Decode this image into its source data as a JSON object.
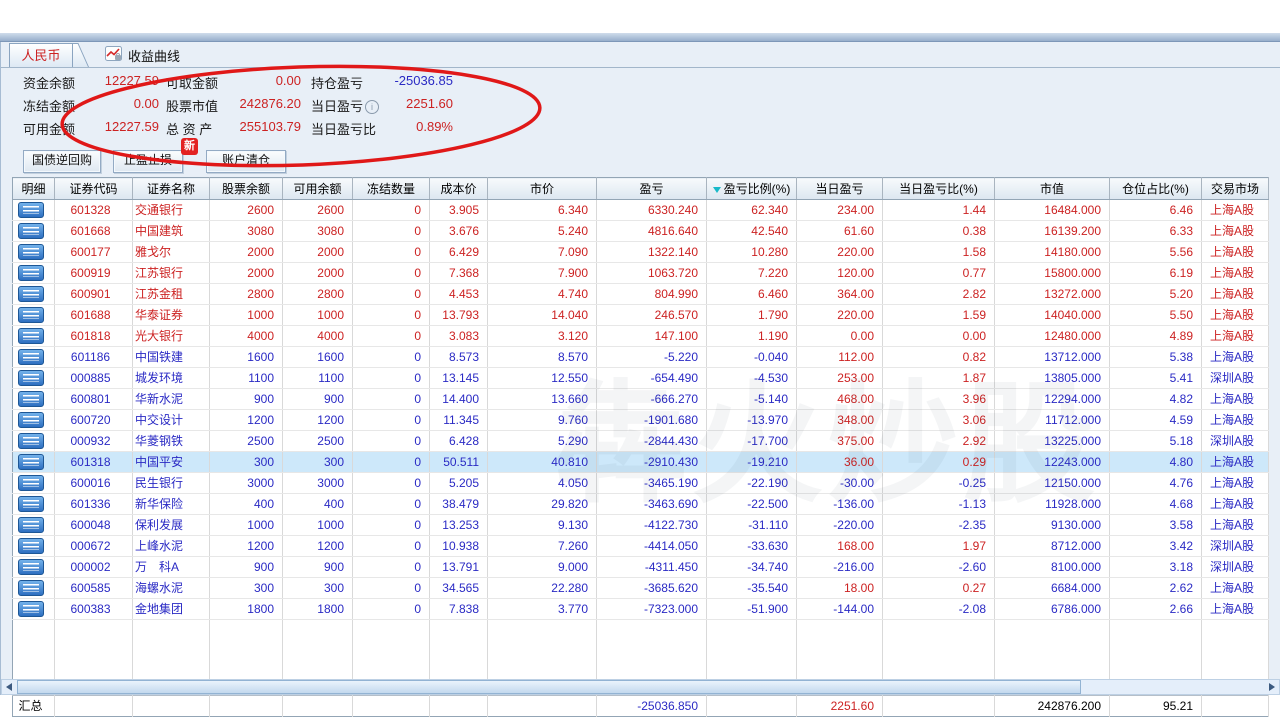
{
  "tabs": {
    "currency": "人民币",
    "curve": "收益曲线"
  },
  "account": {
    "rows": [
      [
        {
          "label": "资金余额",
          "value": "12227.59",
          "color": "red"
        },
        {
          "label": "可取金额",
          "value": "0.00",
          "color": "red"
        },
        {
          "label": "持仓盈亏",
          "value": "-25036.85",
          "color": "blue"
        }
      ],
      [
        {
          "label": "冻结金额",
          "value": "0.00",
          "color": "red"
        },
        {
          "label": "股票市值",
          "value": "242876.20",
          "color": "red"
        },
        {
          "label": "当日盈亏",
          "value": "2251.60",
          "color": "red",
          "info": true
        }
      ],
      [
        {
          "label": "可用金额",
          "value": "12227.59",
          "color": "red"
        },
        {
          "label": "总 资 产",
          "value": "255103.79",
          "color": "red"
        },
        {
          "label": "当日盈亏比",
          "value": "0.89%",
          "color": "red"
        }
      ]
    ]
  },
  "buttons": {
    "reverse_repo": "国债逆回购",
    "stop_profit_loss": "止盈止损",
    "clear_account": "账户清仓"
  },
  "badge_new": "新",
  "watermark": "犇火炒股",
  "colors": {
    "up": "#cc2222",
    "down": "#2a2ac4",
    "annotation": "#e01818",
    "sort_indicator": "#17b9c9",
    "highlight_row": "#cde8fa"
  },
  "table": {
    "columns": [
      {
        "key": "detail",
        "label": "明细",
        "width": 42,
        "align": "c"
      },
      {
        "key": "code",
        "label": "证券代码",
        "width": 78,
        "align": "c"
      },
      {
        "key": "name",
        "label": "证券名称",
        "width": 77,
        "align": "l"
      },
      {
        "key": "balance",
        "label": "股票余额",
        "width": 73,
        "align": "r"
      },
      {
        "key": "available",
        "label": "可用余额",
        "width": 70,
        "align": "r"
      },
      {
        "key": "frozen",
        "label": "冻结数量",
        "width": 77,
        "align": "r"
      },
      {
        "key": "cost",
        "label": "成本价",
        "width": 58,
        "align": "r"
      },
      {
        "key": "price",
        "label": "市价",
        "width": 109,
        "align": "r"
      },
      {
        "key": "pl",
        "label": "盈亏",
        "width": 110,
        "align": "r"
      },
      {
        "key": "pl_pct",
        "label": "盈亏比例(%)",
        "width": 90,
        "align": "r",
        "sorted": true
      },
      {
        "key": "day_pl",
        "label": "当日盈亏",
        "width": 86,
        "align": "r"
      },
      {
        "key": "day_pl_pct",
        "label": "当日盈亏比(%)",
        "width": 112,
        "align": "r"
      },
      {
        "key": "mkt_val",
        "label": "市值",
        "width": 115,
        "align": "r"
      },
      {
        "key": "pos_pct",
        "label": "仓位占比(%)",
        "width": 92,
        "align": "r"
      },
      {
        "key": "market",
        "label": "交易市场",
        "width": 67,
        "align": "c"
      }
    ],
    "rows": [
      {
        "code": "601328",
        "name": "交通银行",
        "balance": "2600",
        "available": "2600",
        "frozen": "0",
        "cost": "3.905",
        "price": "6.340",
        "pl": "6330.240",
        "pl_pct": "62.340",
        "day_pl": "234.00",
        "day_pl_pct": "1.44",
        "mkt_val": "16484.000",
        "pos_pct": "6.46",
        "market": "上海A股",
        "trend": "up"
      },
      {
        "code": "601668",
        "name": "中国建筑",
        "balance": "3080",
        "available": "3080",
        "frozen": "0",
        "cost": "3.676",
        "price": "5.240",
        "pl": "4816.640",
        "pl_pct": "42.540",
        "day_pl": "61.60",
        "day_pl_pct": "0.38",
        "mkt_val": "16139.200",
        "pos_pct": "6.33",
        "market": "上海A股",
        "trend": "up"
      },
      {
        "code": "600177",
        "name": "雅戈尔",
        "balance": "2000",
        "available": "2000",
        "frozen": "0",
        "cost": "6.429",
        "price": "7.090",
        "pl": "1322.140",
        "pl_pct": "10.280",
        "day_pl": "220.00",
        "day_pl_pct": "1.58",
        "mkt_val": "14180.000",
        "pos_pct": "5.56",
        "market": "上海A股",
        "trend": "up"
      },
      {
        "code": "600919",
        "name": "江苏银行",
        "balance": "2000",
        "available": "2000",
        "frozen": "0",
        "cost": "7.368",
        "price": "7.900",
        "pl": "1063.720",
        "pl_pct": "7.220",
        "day_pl": "120.00",
        "day_pl_pct": "0.77",
        "mkt_val": "15800.000",
        "pos_pct": "6.19",
        "market": "上海A股",
        "trend": "up"
      },
      {
        "code": "600901",
        "name": "江苏金租",
        "balance": "2800",
        "available": "2800",
        "frozen": "0",
        "cost": "4.453",
        "price": "4.740",
        "pl": "804.990",
        "pl_pct": "6.460",
        "day_pl": "364.00",
        "day_pl_pct": "2.82",
        "mkt_val": "13272.000",
        "pos_pct": "5.20",
        "market": "上海A股",
        "trend": "up"
      },
      {
        "code": "601688",
        "name": "华泰证券",
        "balance": "1000",
        "available": "1000",
        "frozen": "0",
        "cost": "13.793",
        "price": "14.040",
        "pl": "246.570",
        "pl_pct": "1.790",
        "day_pl": "220.00",
        "day_pl_pct": "1.59",
        "mkt_val": "14040.000",
        "pos_pct": "5.50",
        "market": "上海A股",
        "trend": "up"
      },
      {
        "code": "601818",
        "name": "光大银行",
        "balance": "4000",
        "available": "4000",
        "frozen": "0",
        "cost": "3.083",
        "price": "3.120",
        "pl": "147.100",
        "pl_pct": "1.190",
        "day_pl": "0.00",
        "day_pl_pct": "0.00",
        "mkt_val": "12480.000",
        "pos_pct": "4.89",
        "market": "上海A股",
        "trend": "up"
      },
      {
        "code": "601186",
        "name": "中国铁建",
        "balance": "1600",
        "available": "1600",
        "frozen": "0",
        "cost": "8.573",
        "price": "8.570",
        "pl": "-5.220",
        "pl_pct": "-0.040",
        "day_pl": "112.00",
        "day_pl_pct": "0.82",
        "mkt_val": "13712.000",
        "pos_pct": "5.38",
        "market": "上海A股",
        "trend": "down"
      },
      {
        "code": "000885",
        "name": "城发环境",
        "balance": "1100",
        "available": "1100",
        "frozen": "0",
        "cost": "13.145",
        "price": "12.550",
        "pl": "-654.490",
        "pl_pct": "-4.530",
        "day_pl": "253.00",
        "day_pl_pct": "1.87",
        "mkt_val": "13805.000",
        "pos_pct": "5.41",
        "market": "深圳A股",
        "trend": "down"
      },
      {
        "code": "600801",
        "name": "华新水泥",
        "balance": "900",
        "available": "900",
        "frozen": "0",
        "cost": "14.400",
        "price": "13.660",
        "pl": "-666.270",
        "pl_pct": "-5.140",
        "day_pl": "468.00",
        "day_pl_pct": "3.96",
        "mkt_val": "12294.000",
        "pos_pct": "4.82",
        "market": "上海A股",
        "trend": "down"
      },
      {
        "code": "600720",
        "name": "中交设计",
        "balance": "1200",
        "available": "1200",
        "frozen": "0",
        "cost": "11.345",
        "price": "9.760",
        "pl": "-1901.680",
        "pl_pct": "-13.970",
        "day_pl": "348.00",
        "day_pl_pct": "3.06",
        "mkt_val": "11712.000",
        "pos_pct": "4.59",
        "market": "上海A股",
        "trend": "down"
      },
      {
        "code": "000932",
        "name": "华菱钢铁",
        "balance": "2500",
        "available": "2500",
        "frozen": "0",
        "cost": "6.428",
        "price": "5.290",
        "pl": "-2844.430",
        "pl_pct": "-17.700",
        "day_pl": "375.00",
        "day_pl_pct": "2.92",
        "mkt_val": "13225.000",
        "pos_pct": "5.18",
        "market": "深圳A股",
        "trend": "down"
      },
      {
        "code": "601318",
        "name": "中国平安",
        "balance": "300",
        "available": "300",
        "frozen": "0",
        "cost": "50.511",
        "price": "40.810",
        "pl": "-2910.430",
        "pl_pct": "-19.210",
        "day_pl": "36.00",
        "day_pl_pct": "0.29",
        "mkt_val": "12243.000",
        "pos_pct": "4.80",
        "market": "上海A股",
        "trend": "down",
        "highlight": true
      },
      {
        "code": "600016",
        "name": "民生银行",
        "balance": "3000",
        "available": "3000",
        "frozen": "0",
        "cost": "5.205",
        "price": "4.050",
        "pl": "-3465.190",
        "pl_pct": "-22.190",
        "day_pl": "-30.00",
        "day_pl_pct": "-0.25",
        "mkt_val": "12150.000",
        "pos_pct": "4.76",
        "market": "上海A股",
        "trend": "down"
      },
      {
        "code": "601336",
        "name": "新华保险",
        "balance": "400",
        "available": "400",
        "frozen": "0",
        "cost": "38.479",
        "price": "29.820",
        "pl": "-3463.690",
        "pl_pct": "-22.500",
        "day_pl": "-136.00",
        "day_pl_pct": "-1.13",
        "mkt_val": "11928.000",
        "pos_pct": "4.68",
        "market": "上海A股",
        "trend": "down"
      },
      {
        "code": "600048",
        "name": "保利发展",
        "balance": "1000",
        "available": "1000",
        "frozen": "0",
        "cost": "13.253",
        "price": "9.130",
        "pl": "-4122.730",
        "pl_pct": "-31.110",
        "day_pl": "-220.00",
        "day_pl_pct": "-2.35",
        "mkt_val": "9130.000",
        "pos_pct": "3.58",
        "market": "上海A股",
        "trend": "down"
      },
      {
        "code": "000672",
        "name": "上峰水泥",
        "balance": "1200",
        "available": "1200",
        "frozen": "0",
        "cost": "10.938",
        "price": "7.260",
        "pl": "-4414.050",
        "pl_pct": "-33.630",
        "day_pl": "168.00",
        "day_pl_pct": "1.97",
        "mkt_val": "8712.000",
        "pos_pct": "3.42",
        "market": "深圳A股",
        "trend": "down"
      },
      {
        "code": "000002",
        "name": "万　科A",
        "balance": "900",
        "available": "900",
        "frozen": "0",
        "cost": "13.791",
        "price": "9.000",
        "pl": "-4311.450",
        "pl_pct": "-34.740",
        "day_pl": "-216.00",
        "day_pl_pct": "-2.60",
        "mkt_val": "8100.000",
        "pos_pct": "3.18",
        "market": "深圳A股",
        "trend": "down"
      },
      {
        "code": "600585",
        "name": "海螺水泥",
        "balance": "300",
        "available": "300",
        "frozen": "0",
        "cost": "34.565",
        "price": "22.280",
        "pl": "-3685.620",
        "pl_pct": "-35.540",
        "day_pl": "18.00",
        "day_pl_pct": "0.27",
        "mkt_val": "6684.000",
        "pos_pct": "2.62",
        "market": "上海A股",
        "trend": "down"
      },
      {
        "code": "600383",
        "name": "金地集团",
        "balance": "1800",
        "available": "1800",
        "frozen": "0",
        "cost": "7.838",
        "price": "3.770",
        "pl": "-7323.000",
        "pl_pct": "-51.900",
        "day_pl": "-144.00",
        "day_pl_pct": "-2.08",
        "mkt_val": "6786.000",
        "pos_pct": "2.66",
        "market": "上海A股",
        "trend": "down"
      }
    ],
    "summary": {
      "label": "汇总",
      "pl": "-25036.850",
      "day_pl": "2251.60",
      "mkt_val": "242876.200",
      "pos_pct": "95.21"
    }
  }
}
